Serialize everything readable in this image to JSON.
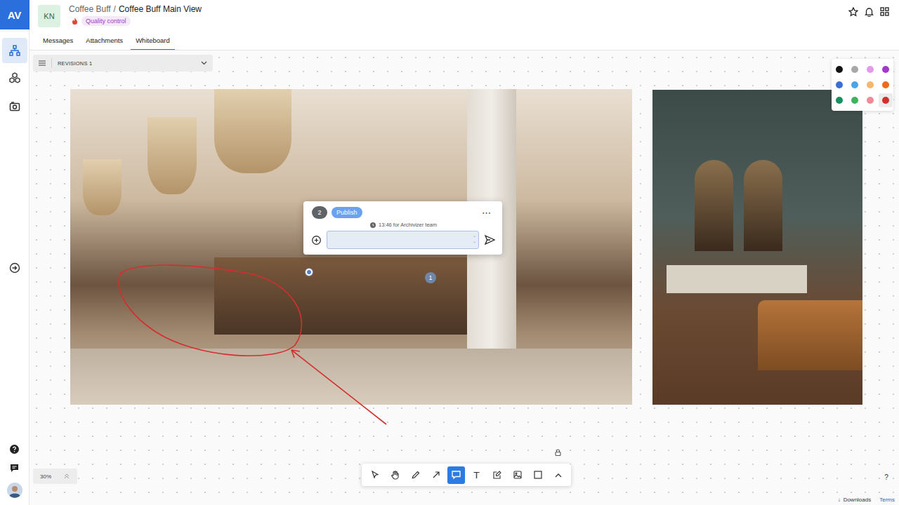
{
  "logo": "AV",
  "sidebar": {
    "items": [
      {
        "kind": "sitemap",
        "selected": true
      },
      {
        "kind": "cubes",
        "selected": false
      },
      {
        "kind": "camera",
        "selected": false
      }
    ],
    "collapse": {
      "kind": "arrow"
    },
    "bottom": [
      {
        "kind": "help"
      },
      {
        "kind": "chat"
      },
      {
        "kind": "avatar"
      }
    ]
  },
  "header": {
    "avatar": "KN",
    "breadcrumb": [
      "Coffee Buff",
      "Coffee Buff Main View"
    ],
    "separator": "/",
    "tag": "Quality control"
  },
  "tabs": [
    {
      "label": "Messages",
      "selected": false
    },
    {
      "label": "Attachments",
      "selected": false
    },
    {
      "label": "Whiteboard",
      "selected": true
    }
  ],
  "revisions": {
    "label": "REVISIONS 1"
  },
  "palette": [
    {
      "color": "#141414",
      "selected": false
    },
    {
      "color": "#a8a8a8",
      "selected": false
    },
    {
      "color": "#e39be9",
      "selected": false
    },
    {
      "color": "#a23ac9",
      "selected": false
    },
    {
      "color": "#3b6fd6",
      "selected": false
    },
    {
      "color": "#4ba4e9",
      "selected": false
    },
    {
      "color": "#f5b66e",
      "selected": false
    },
    {
      "color": "#ee6a1c",
      "selected": false
    },
    {
      "color": "#16905e",
      "selected": false
    },
    {
      "color": "#3cb55a",
      "selected": false
    },
    {
      "color": "#f08b95",
      "selected": false
    },
    {
      "color": "#d42f2f",
      "selected": true
    }
  ],
  "comment": {
    "count": "2",
    "publish": "Publish",
    "menu": "⋯",
    "meta": "13:46 for Archivizer team"
  },
  "pins": [
    {
      "number": "1"
    }
  ],
  "zoom": {
    "value": "30%"
  },
  "toolbar": [
    {
      "kind": "select",
      "selected": false
    },
    {
      "kind": "hand",
      "selected": false
    },
    {
      "kind": "pen",
      "selected": false
    },
    {
      "kind": "arrow",
      "selected": false
    },
    {
      "kind": "comment",
      "selected": true
    },
    {
      "kind": "text",
      "glyph": "T",
      "selected": false
    },
    {
      "kind": "note",
      "selected": false
    },
    {
      "kind": "image",
      "selected": false
    },
    {
      "kind": "rect",
      "selected": false
    },
    {
      "kind": "more",
      "selected": false
    }
  ],
  "footer": {
    "downloads_icon": "↓",
    "downloads": "Downloads",
    "terms": "Terms",
    "help": "?"
  }
}
